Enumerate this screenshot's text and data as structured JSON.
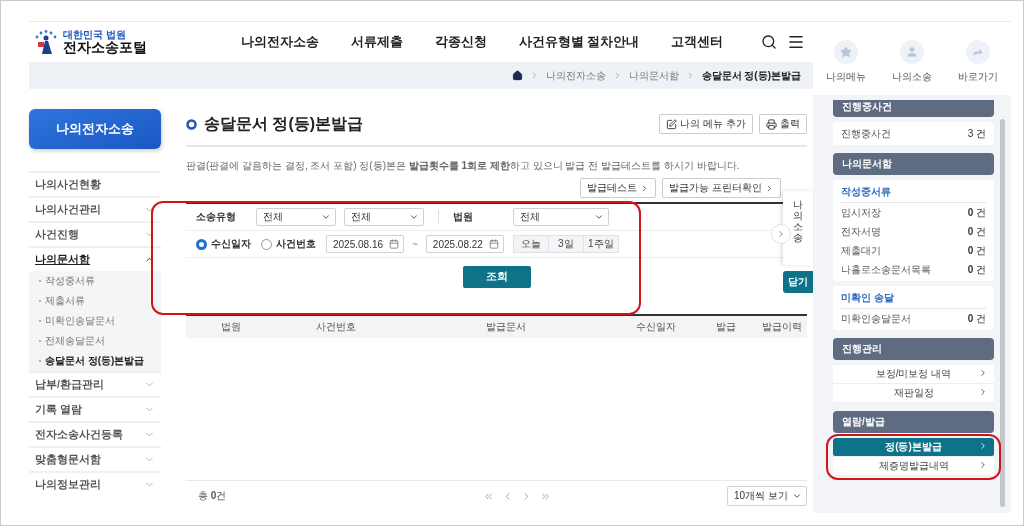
{
  "header": {
    "logo": {
      "subtitle": "대한민국 법원",
      "title": "전자소송포털"
    },
    "nav": [
      "나의전자소송",
      "서류제출",
      "각종신청",
      "사건유형별 절차안내",
      "고객센터"
    ]
  },
  "breadcrumb": [
    "나의전자소송",
    "나의문서함",
    "송달문서 정(등)본발급"
  ],
  "sidebar": {
    "title": "나의전자소송",
    "items": [
      {
        "label": "나의사건현황",
        "kind": "link"
      },
      {
        "label": "나의사건관리",
        "kind": "group",
        "expanded": false
      },
      {
        "label": "사건진행",
        "kind": "group",
        "expanded": false
      },
      {
        "label": "나의문서함",
        "kind": "group",
        "expanded": true,
        "children": [
          {
            "label": "작성중서류",
            "selected": false
          },
          {
            "label": "제출서류",
            "selected": false
          },
          {
            "label": "미확인송달문서",
            "selected": false
          },
          {
            "label": "전체송달문서",
            "selected": false
          },
          {
            "label": "송달문서 정(등)본발급",
            "selected": true
          }
        ]
      },
      {
        "label": "납부/환급관리",
        "kind": "group",
        "expanded": false
      },
      {
        "label": "기록 열람",
        "kind": "group",
        "expanded": false
      },
      {
        "label": "전자소송사건등록",
        "kind": "group",
        "expanded": false
      },
      {
        "label": "맞춤형문서함",
        "kind": "group",
        "expanded": false
      },
      {
        "label": "나의정보관리",
        "kind": "group",
        "expanded": false
      }
    ]
  },
  "page": {
    "title": "송달문서 정(등)본발급",
    "actions": [
      "나의 메뉴 추가",
      "출력"
    ],
    "notice": "판결(판결에 갈음하는 결정, 조서 포함) 정(등)본은 **발급횟수를 1회로 제한**하고 있으니 발급 전 발급테스트를 하시기 바랍니다.",
    "tools": [
      "발급테스트",
      "발급가능 프린터확인"
    ],
    "search": {
      "type_label": "소송유형",
      "type_selects": [
        "전체",
        "전체"
      ],
      "court_label": "법원",
      "court_select": "전체",
      "radios": [
        {
          "label": "수신일자",
          "selected": true
        },
        {
          "label": "사건번호",
          "selected": false
        }
      ],
      "date_from": "2025.08.16",
      "date_to": "2025.08.22",
      "range_separator": "~",
      "quick_ranges": [
        "오늘",
        "3일",
        "1주일"
      ],
      "submit": "조회"
    },
    "table": {
      "columns": [
        "법원",
        "사건번호",
        "발급문서",
        "수신일자",
        "발급",
        "발급이력"
      ]
    },
    "footer": {
      "total": "총 **0**건",
      "page_size": "10개씩 보기"
    }
  },
  "side_tab": {
    "label": "나의소송",
    "close": "닫기"
  },
  "quick_menu": [
    "나의메뉴",
    "나의소송",
    "바로가기"
  ],
  "panel": [
    {
      "title": "진행중사건",
      "kind": "counts",
      "groups": [
        {
          "rows": [
            {
              "label": "진행중사건",
              "count": "3 건"
            }
          ]
        }
      ]
    },
    {
      "title": "나의문서함",
      "kind": "counts",
      "groups": [
        {
          "heading": "작성중서류",
          "rows": [
            {
              "label": "임시저장",
              "count": "**0** 건"
            },
            {
              "label": "전자서명",
              "count": "**0** 건"
            },
            {
              "label": "제출대기",
              "count": "**0** 건"
            },
            {
              "label": "나홀로소송문서목록",
              "count": "**0** 건"
            }
          ]
        },
        {
          "heading": "미확인 송달",
          "rows": [
            {
              "label": "미확인송달문서",
              "count": "**0** 건"
            }
          ]
        }
      ]
    },
    {
      "title": "진행관리",
      "kind": "links",
      "items": [
        {
          "label": "보정/미보정 내역",
          "selected": false
        },
        {
          "label": "재판일정",
          "selected": false
        }
      ]
    },
    {
      "title": "열람/발급",
      "kind": "links",
      "items": [
        {
          "label": "정(등)본발급",
          "selected": true
        },
        {
          "label": "제증명발급내역",
          "selected": false
        }
      ]
    }
  ]
}
